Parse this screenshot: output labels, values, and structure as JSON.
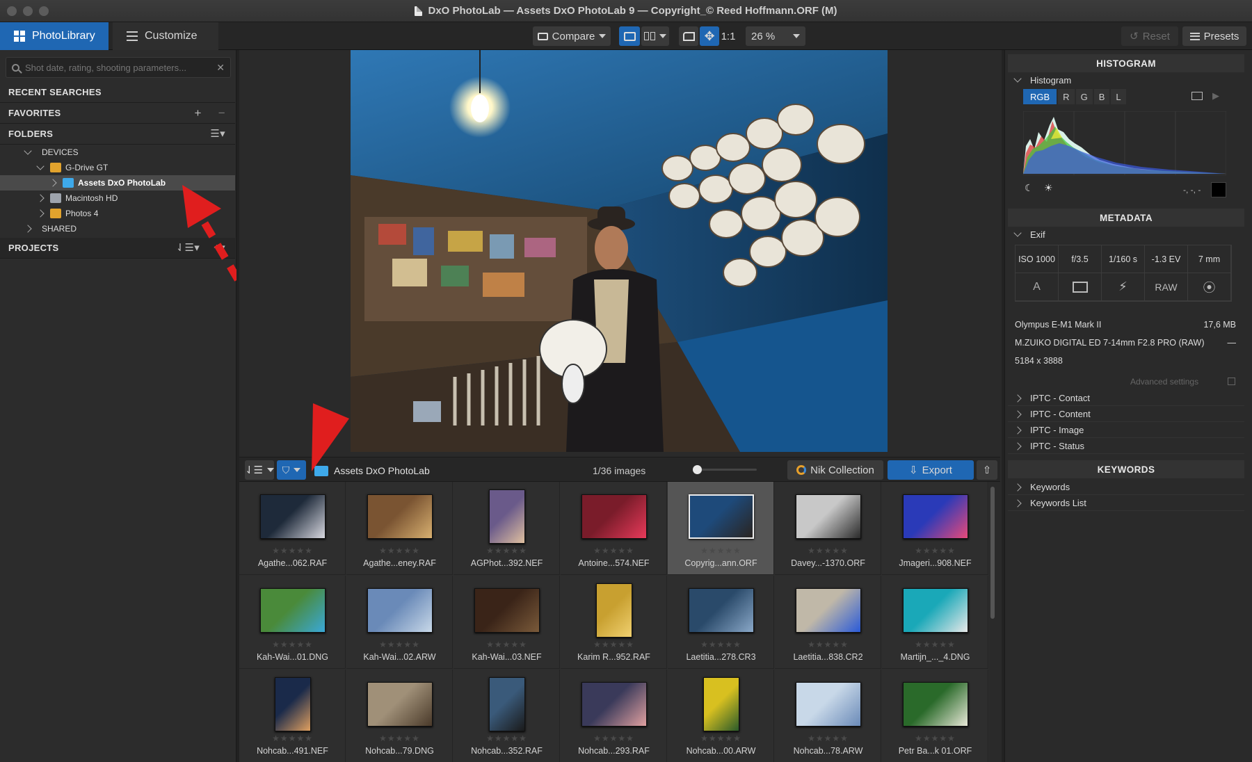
{
  "window": {
    "title": "DxO PhotoLab — Assets DxO PhotoLab 9 — Copyright_© Reed Hoffmann.ORF (M)"
  },
  "toolbar": {
    "tab_library": "PhotoLibrary",
    "tab_customize": "Customize",
    "compare_label": "Compare",
    "zoom_1to1": "1:1",
    "zoom_value": "26 %",
    "reset_label": "Reset",
    "presets_label": "Presets"
  },
  "search": {
    "placeholder": "Shot date, rating, shooting parameters..."
  },
  "left": {
    "recent_searches": "RECENT SEARCHES",
    "favorites": "FAVORITES",
    "folders": "FOLDERS",
    "devices": "DEVICES",
    "drive": "G-Drive GT",
    "selected_folder": "Assets DxO PhotoLab",
    "macintosh": "Macintosh HD",
    "photos": "Photos 4",
    "shared": "SHARED",
    "projects": "PROJECTS"
  },
  "filmstrip": {
    "folder": "Assets DxO PhotoLab",
    "count": "1/36 images",
    "nik": "Nik Collection",
    "export": "Export",
    "stars": "★★★★★",
    "rows": [
      [
        "Agathe...062.RAF",
        "Agathe...eney.RAF",
        "AGPhot...392.NEF",
        "Antoine...574.NEF",
        "Copyrig...ann.ORF",
        "Davey...-1370.ORF",
        "Jmageri...908.NEF"
      ],
      [
        "Kah-Wai...01.DNG",
        "Kah-Wai...02.ARW",
        "Kah-Wai...03.NEF",
        "Karim R...952.RAF",
        "Laetitia...278.CR3",
        "Laetitia...838.CR2",
        "Martijn_..._4.DNG"
      ],
      [
        "Nohcab...491.NEF",
        "Nohcab...79.DNG",
        "Nohcab...352.RAF",
        "Nohcab...293.RAF",
        "Nohcab...00.ARW",
        "Nohcab...78.ARW",
        "Petr Ba...k 01.ORF"
      ]
    ]
  },
  "histogram": {
    "header": "HISTOGRAM",
    "sub": "Histogram",
    "channels": [
      "RGB",
      "R",
      "G",
      "B",
      "L"
    ],
    "readout": "-, -, -"
  },
  "metadata": {
    "header": "METADATA",
    "exif_label": "Exif",
    "exif_values": [
      "ISO 1000",
      "f/3.5",
      "1/160 s",
      "-1.3 EV",
      "7 mm"
    ],
    "raw_label": "RAW",
    "a_label": "A",
    "camera": "Olympus E-M1 Mark II",
    "filesize": "17,6 MB",
    "lens": "M.ZUIKO DIGITAL ED 7-14mm F2.8 PRO (RAW)",
    "lens_dash": "—",
    "dimensions": "5184 x 3888",
    "advanced": "Advanced settings",
    "iptc": [
      "IPTC - Contact",
      "IPTC - Content",
      "IPTC - Image",
      "IPTC - Status"
    ]
  },
  "keywords": {
    "header": "KEYWORDS",
    "items": [
      "Keywords",
      "Keywords List"
    ]
  },
  "colors": {
    "accent": "#1f67b3",
    "annotation_arrow": "#e01e1e"
  }
}
